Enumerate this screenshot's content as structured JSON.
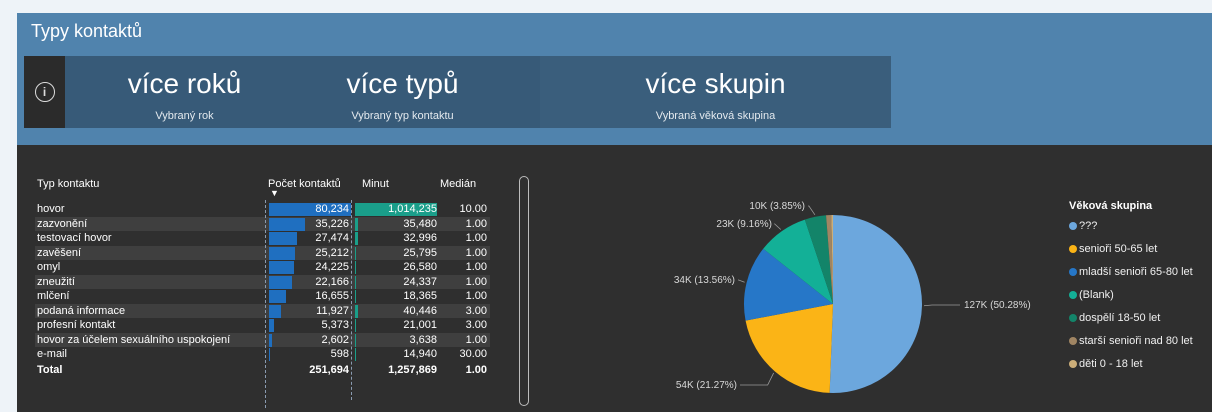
{
  "title": "Typy kontaktů",
  "cards": {
    "years": {
      "value": "více roků",
      "label": "Vybraný rok"
    },
    "types": {
      "value": "více typů",
      "label": "Vybraný typ kontaktu"
    },
    "groups": {
      "value": "více skupin",
      "label": "Vybraná věková skupina"
    }
  },
  "info_icon": "info-icon",
  "table": {
    "headers": {
      "type": "Typ kontaktu",
      "count": "Počet kontaktů",
      "minutes": "Minut",
      "median": "Medián"
    },
    "sort_indicator": "▼",
    "rows": [
      {
        "name": "hovor",
        "count": "80,234",
        "minutes": "1,014,235",
        "median": "10.00",
        "count_val": 80234,
        "min_val": 1014235
      },
      {
        "name": "zazvonění",
        "count": "35,226",
        "minutes": "35,480",
        "median": "1.00",
        "count_val": 35226,
        "min_val": 35480
      },
      {
        "name": "testovací hovor",
        "count": "27,474",
        "minutes": "32,996",
        "median": "1.00",
        "count_val": 27474,
        "min_val": 32996
      },
      {
        "name": "zavěšení",
        "count": "25,212",
        "minutes": "25,795",
        "median": "1.00",
        "count_val": 25212,
        "min_val": 25795
      },
      {
        "name": "omyl",
        "count": "24,225",
        "minutes": "26,580",
        "median": "1.00",
        "count_val": 24225,
        "min_val": 26580
      },
      {
        "name": "zneužití",
        "count": "22,166",
        "minutes": "24,337",
        "median": "1.00",
        "count_val": 22166,
        "min_val": 24337
      },
      {
        "name": "mlčení",
        "count": "16,655",
        "minutes": "18,365",
        "median": "1.00",
        "count_val": 16655,
        "min_val": 18365
      },
      {
        "name": "podaná informace",
        "count": "11,927",
        "minutes": "40,446",
        "median": "3.00",
        "count_val": 11927,
        "min_val": 40446
      },
      {
        "name": "profesní kontakt",
        "count": "5,373",
        "minutes": "21,001",
        "median": "3.00",
        "count_val": 5373,
        "min_val": 21001
      },
      {
        "name": "hovor za účelem sexuálního uspokojení",
        "count": "2,602",
        "minutes": "3,638",
        "median": "1.00",
        "count_val": 2602,
        "min_val": 3638
      },
      {
        "name": "e-mail",
        "count": "598",
        "minutes": "14,940",
        "median": "30.00",
        "count_val": 598,
        "min_val": 14940
      }
    ],
    "total": {
      "name": "Total",
      "count": "251,694",
      "minutes": "1,257,869",
      "median": "1.00"
    }
  },
  "chart_data": {
    "type": "pie",
    "slices": [
      {
        "label": "127K (50.28%)",
        "value": 127,
        "percent": 50.28,
        "color": "#6ca7dd",
        "group": "???"
      },
      {
        "label": "54K (21.27%)",
        "value": 54,
        "percent": 21.27,
        "color": "#fbb416",
        "group": "senioři 50-65 let"
      },
      {
        "label": "34K (13.56%)",
        "value": 34,
        "percent": 13.56,
        "color": "#2677c8",
        "group": "mladší senioři 65-80 let"
      },
      {
        "label": "23K (9.16%)",
        "value": 23,
        "percent": 9.16,
        "color": "#13b097",
        "group": "(Blank)"
      },
      {
        "label": "10K (3.85%)",
        "value": 10,
        "percent": 3.85,
        "color": "#138469",
        "group": "dospělí 18-50 let"
      },
      {
        "label": "",
        "value": 2,
        "percent": 0.94,
        "color": "#a08563",
        "group": "starší senioři nad 80 let"
      },
      {
        "label": "",
        "value": 1,
        "percent": 0.3,
        "color": "#ccae79",
        "group": "děti 0 - 18 let"
      }
    ],
    "legend_title": "Věková skupina",
    "legend_position": "right"
  }
}
